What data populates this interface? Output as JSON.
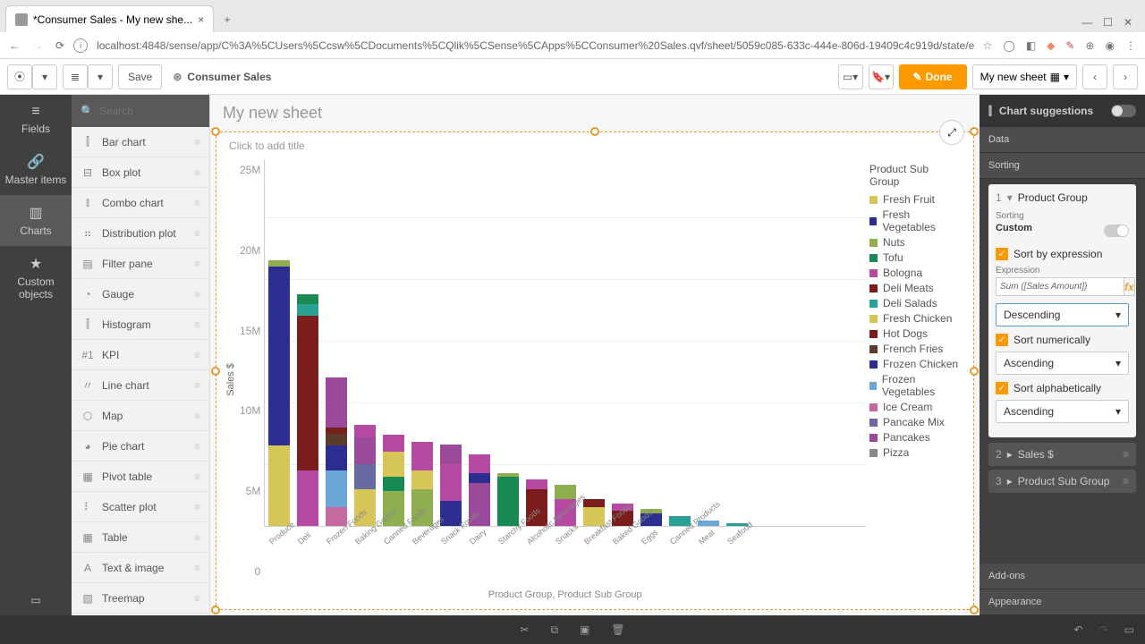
{
  "browser": {
    "tab_title": "*Consumer Sales - My new she...",
    "url": "localhost:4848/sense/app/C%3A%5CUsers%5Ccsw%5CDocuments%5CQlik%5CSense%5CApps%5CConsumer%20Sales.qvf/sheet/5059c085-633c-444e-806d-19409c4c919d/state/edit/language/en"
  },
  "toolbar": {
    "save": "Save",
    "app_name": "Consumer Sales",
    "done": "Done",
    "sheet_name": "My new sheet"
  },
  "left_rail": {
    "items": [
      {
        "label": "Fields",
        "icon": "≡"
      },
      {
        "label": "Master items",
        "icon": "🔗"
      },
      {
        "label": "Charts",
        "icon": "▥"
      },
      {
        "label": "Custom objects",
        "icon": "★"
      }
    ]
  },
  "asset_search_placeholder": "Search",
  "chart_types": [
    {
      "label": "Bar chart",
      "icon": "⫿"
    },
    {
      "label": "Box plot",
      "icon": "⊟"
    },
    {
      "label": "Combo chart",
      "icon": "⫾"
    },
    {
      "label": "Distribution plot",
      "icon": "⠶"
    },
    {
      "label": "Filter pane",
      "icon": "▤"
    },
    {
      "label": "Gauge",
      "icon": "◔"
    },
    {
      "label": "Histogram",
      "icon": "⫿"
    },
    {
      "label": "KPI",
      "icon": "#1"
    },
    {
      "label": "Line chart",
      "icon": "〃"
    },
    {
      "label": "Map",
      "icon": "⬡"
    },
    {
      "label": "Pie chart",
      "icon": "◕"
    },
    {
      "label": "Pivot table",
      "icon": "▦"
    },
    {
      "label": "Scatter plot",
      "icon": "⠇"
    },
    {
      "label": "Table",
      "icon": "▦"
    },
    {
      "label": "Text & image",
      "icon": "A"
    },
    {
      "label": "Treemap",
      "icon": "▧"
    }
  ],
  "sheet": {
    "title": "My new sheet",
    "chart_placeholder": "Click to add title"
  },
  "chart_data": {
    "type": "bar",
    "stacked": true,
    "title": "",
    "ylabel": "Sales $",
    "xlabel": "Product Group, Product Sub Group",
    "ylim": [
      0,
      25000000
    ],
    "y_ticks": [
      "25M",
      "20M",
      "15M",
      "10M",
      "5M",
      "0"
    ],
    "categories": [
      "Produce",
      "Deli",
      "Frozen Foods",
      "Baking Goods",
      "Canned Foods",
      "Beverages",
      "Snack Foods",
      "Dairy",
      "Starchy Foods",
      "Alcoholic Beverages",
      "Snacks",
      "Breakfast Foods",
      "Baked Goods",
      "Eggs",
      "Canned Products",
      "Meat",
      "Seafood"
    ],
    "legend_title": "Product Sub Group",
    "legend": [
      {
        "name": "Fresh Fruit",
        "color": "#d6c65a"
      },
      {
        "name": "Fresh Vegetables",
        "color": "#2b2e8f"
      },
      {
        "name": "Nuts",
        "color": "#8fae4f"
      },
      {
        "name": "Tofu",
        "color": "#1a8a54"
      },
      {
        "name": "Bologna",
        "color": "#b54aa3"
      },
      {
        "name": "Deli Meats",
        "color": "#7a1d1d"
      },
      {
        "name": "Deli Salads",
        "color": "#2aa095"
      },
      {
        "name": "Fresh Chicken",
        "color": "#d6c65a"
      },
      {
        "name": "Hot Dogs",
        "color": "#7a1d1d"
      },
      {
        "name": "French Fries",
        "color": "#5a3b2e"
      },
      {
        "name": "Frozen Chicken",
        "color": "#2b2e8f"
      },
      {
        "name": "Frozen Vegetables",
        "color": "#6aa7d6"
      },
      {
        "name": "Ice Cream",
        "color": "#c46a9e"
      },
      {
        "name": "Pancake Mix",
        "color": "#6a6aa3"
      },
      {
        "name": "Pancakes",
        "color": "#9b4a9b"
      },
      {
        "name": "Pizza",
        "color": "#888"
      }
    ],
    "series_totals": [
      21500000,
      18800000,
      12000000,
      8200000,
      7400000,
      6800000,
      6600000,
      5800000,
      4300000,
      3800000,
      3300000,
      2200000,
      1800000,
      1400000,
      800000,
      400000,
      250000
    ]
  },
  "prop": {
    "header": "Chart suggestions",
    "sections": {
      "data": "Data",
      "sorting": "Sorting",
      "addons": "Add-ons",
      "appearance": "Appearance"
    },
    "sort1": {
      "num": "1",
      "name": "Product Group",
      "sorting_label": "Sorting",
      "sorting_value": "Custom",
      "sort_by_expr": "Sort by expression",
      "expr_label": "Expression",
      "expr_value": "Sum ([Sales Amount])",
      "order1": "Descending",
      "sort_num": "Sort numerically",
      "order2": "Ascending",
      "sort_alpha": "Sort alphabetically",
      "order3": "Ascending"
    },
    "sort2": {
      "num": "2",
      "name": "Sales $"
    },
    "sort3": {
      "num": "3",
      "name": "Product Sub Group"
    }
  }
}
